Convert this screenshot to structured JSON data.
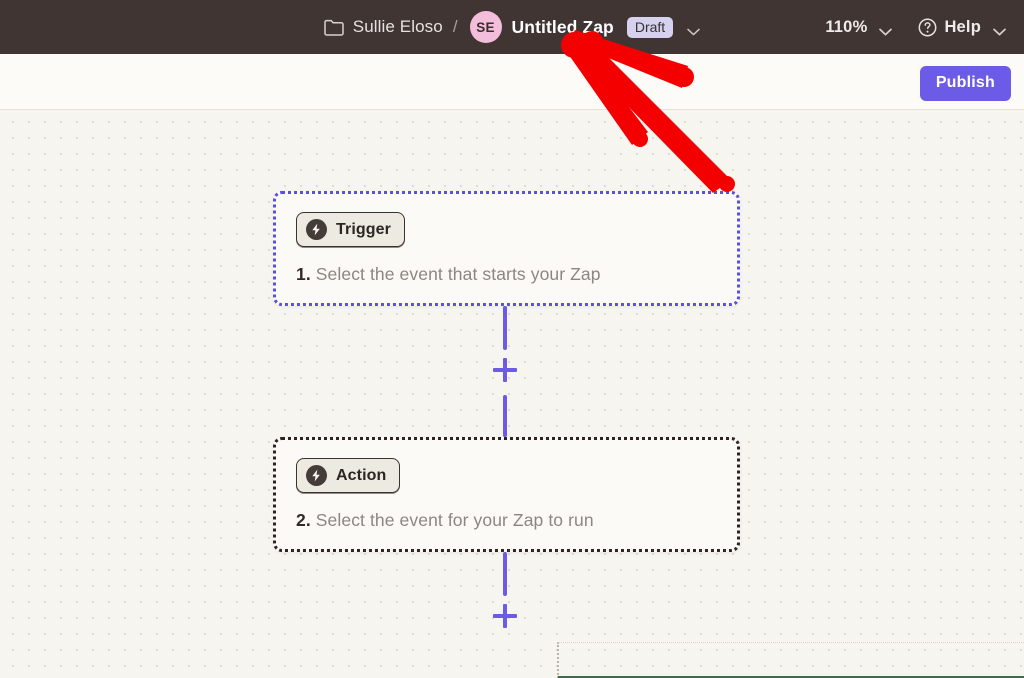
{
  "header": {
    "folder_icon": "folder-icon",
    "account_name": "Sullie Eloso",
    "separator": "/",
    "avatar_initials": "SE",
    "zap_title": "Untitled Zap",
    "status_badge": "Draft",
    "title_dropdown_icon": "chevron-down-icon",
    "zoom_level": "110%",
    "zoom_dropdown_icon": "chevron-down-icon",
    "help_icon": "question-circle-icon",
    "help_label": "Help",
    "help_dropdown_icon": "chevron-down-icon",
    "background_color": "#403533"
  },
  "toolbar": {
    "publish_label": "Publish",
    "publish_color": "#6B5BE6",
    "background_color": "#FCFBF8"
  },
  "canvas": {
    "background_color": "#F7F5F0",
    "dot_color": "#DFD9CF"
  },
  "flow": {
    "nodes": [
      {
        "badge_label": "Trigger",
        "badge_icon": "lightning-bolt-icon",
        "step_number": "1.",
        "description": "Select the event that starts your Zap",
        "selected": true,
        "border_color": "#5B4FE0"
      },
      {
        "badge_label": "Action",
        "badge_icon": "lightning-bolt-icon",
        "step_number": "2.",
        "description": "Select the event for your Zap to run",
        "selected": false,
        "border_color": "#2A2422"
      }
    ],
    "connector_color": "#6B5BE6",
    "add_step_icon": "plus-icon"
  },
  "annotation": {
    "arrow_color": "#F50000",
    "points_to": "Untitled Zap"
  }
}
